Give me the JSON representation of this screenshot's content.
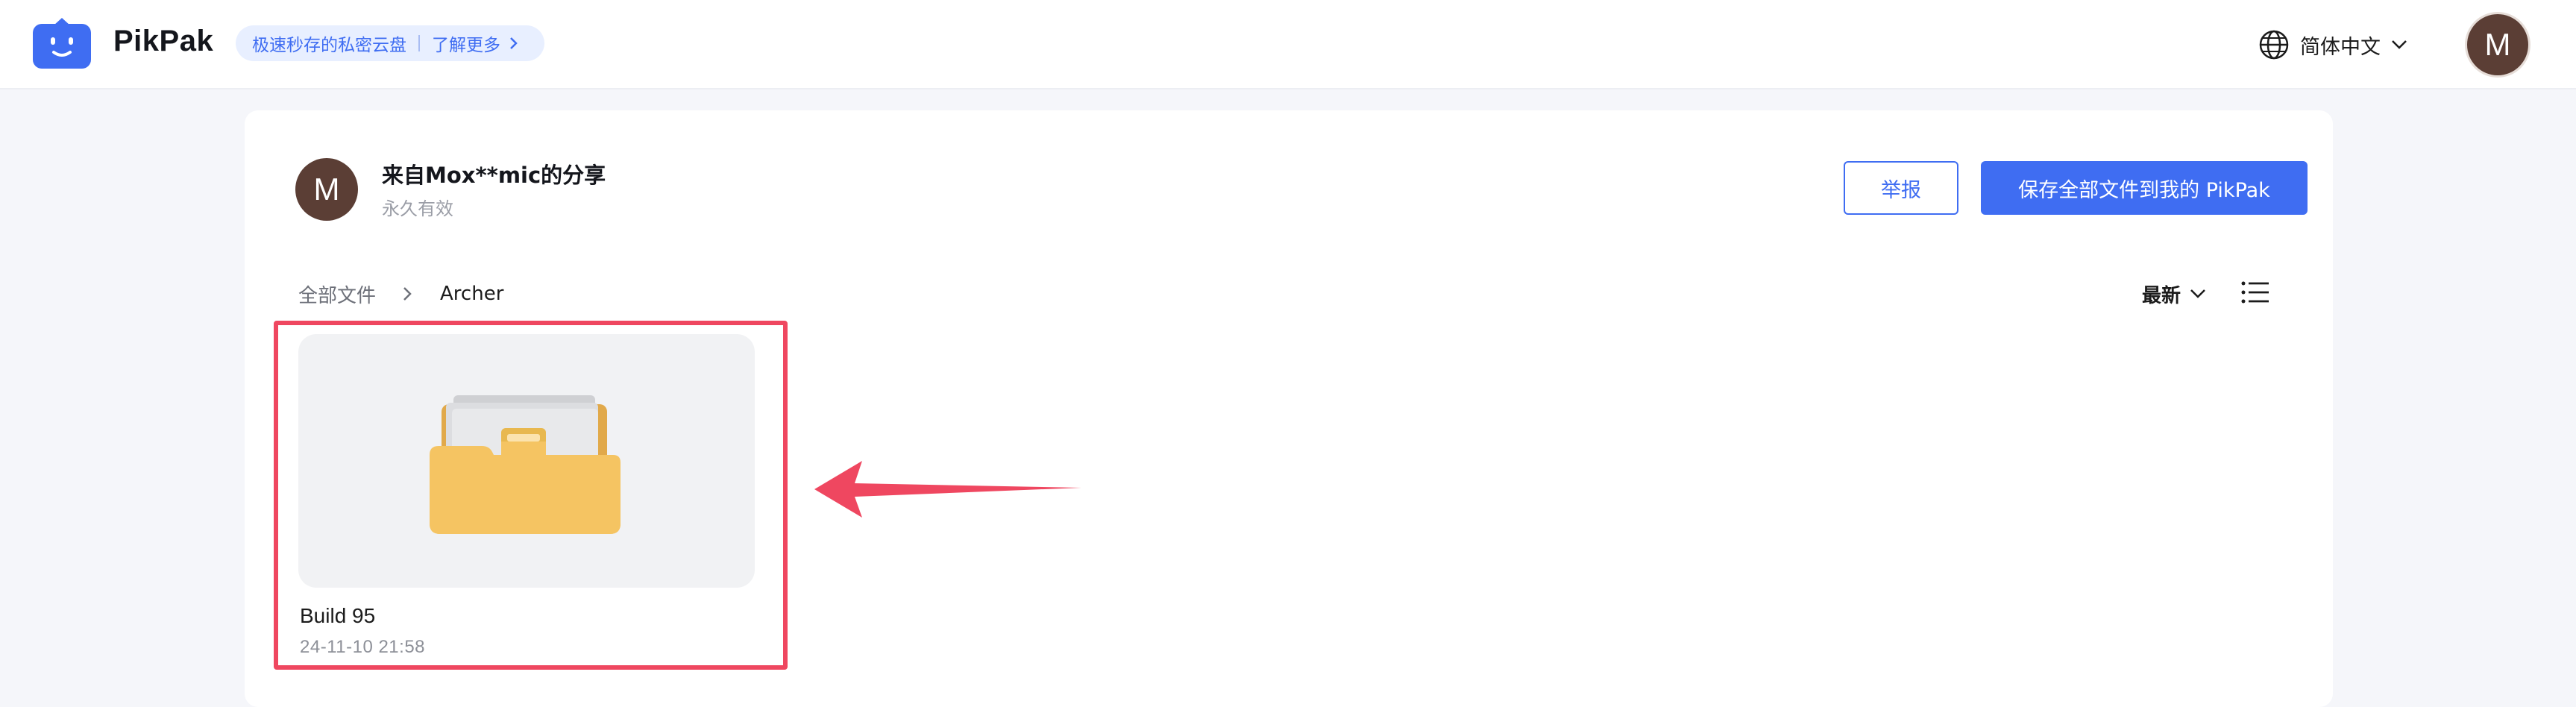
{
  "header": {
    "brand": "PikPak",
    "slogan": "极速秒存的私密云盘",
    "learn_more": "了解更多",
    "language": "简体中文",
    "user_initial": "M"
  },
  "share": {
    "owner_initial": "M",
    "title": "来自Mox**mic的分享",
    "validity": "永久有效",
    "report_label": "举报",
    "save_all_label": "保存全部文件到我的 PikPak"
  },
  "breadcrumb": {
    "root": "全部文件",
    "current": "Archer"
  },
  "toolbar": {
    "sort_label": "最新"
  },
  "files": [
    {
      "name": "Build 95",
      "date": "24-11-10 21:58",
      "type": "folder"
    }
  ],
  "colors": {
    "accent": "#3f6df2",
    "annotation": "#ef4760",
    "folder": "#f5c462"
  }
}
